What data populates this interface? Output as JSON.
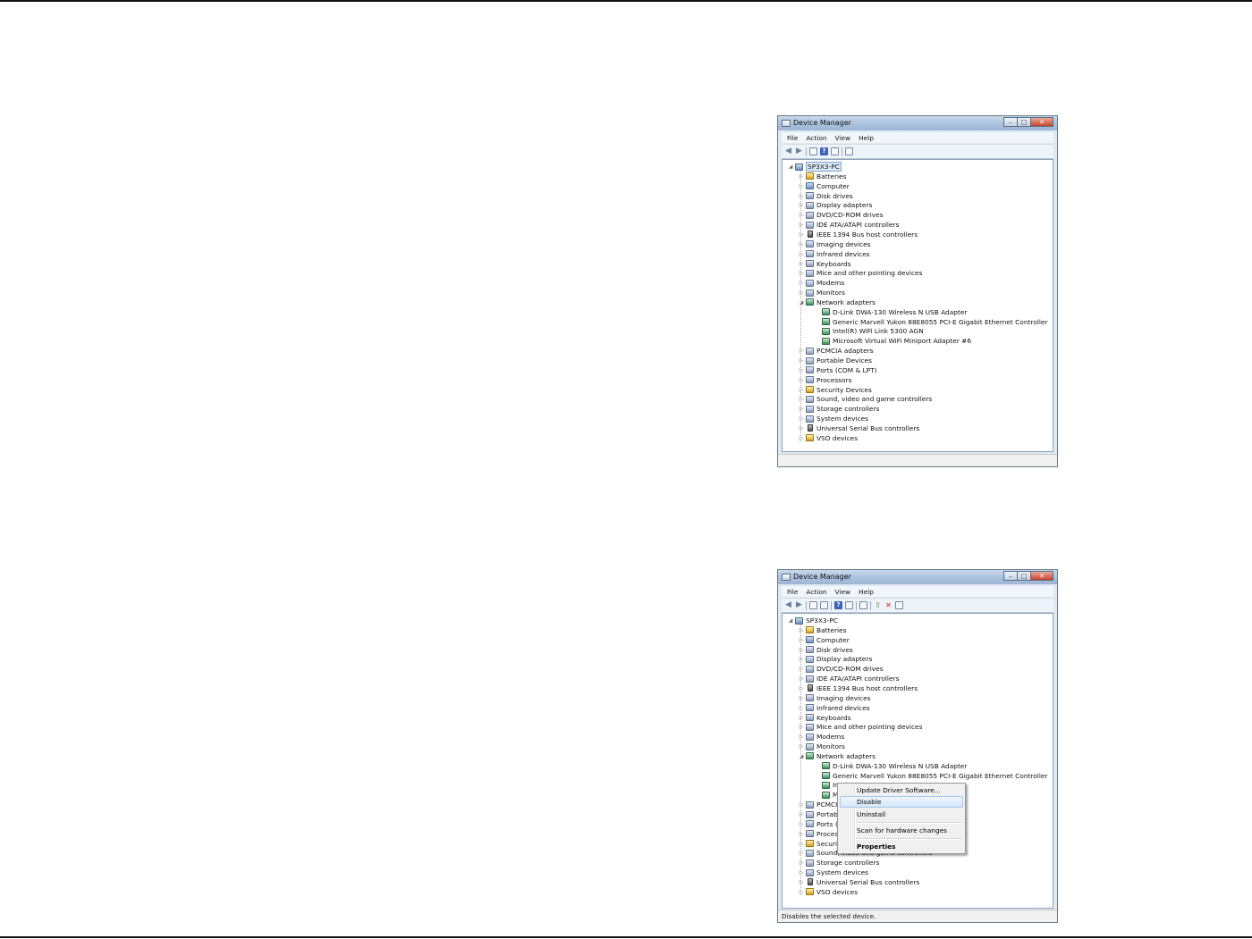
{
  "windows": [
    {
      "title": "Device Manager",
      "menu": [
        "File",
        "Action",
        "View",
        "Help"
      ],
      "toolbar_icons": [
        "back-arrow-icon",
        "forward-arrow-icon",
        "sep",
        "console-tree-icon",
        "help-icon",
        "properties-icon",
        "sep",
        "scan-hardware-icon"
      ],
      "root": "SP3X3-PC",
      "categories": [
        "Batteries",
        "Computer",
        "Disk drives",
        "Display adapters",
        "DVD/CD-ROM drives",
        "IDE ATA/ATAPI controllers",
        "IEEE 1394 Bus host controllers",
        "Imaging devices",
        "Infrared devices",
        "Keyboards",
        "Mice and other pointing devices",
        "Modems",
        "Monitors",
        "Network adapters"
      ],
      "network_devices": [
        "D-Link DWA-130 Wireless N USB Adapter",
        "Generic Marvell Yukon 88E8055 PCI-E Gigabit Ethernet Controller",
        "Intel(R) WiFi Link 5300 AGN",
        "Microsoft Virtual WiFi Miniport Adapter #6"
      ],
      "categories_after": [
        "PCMCIA adapters",
        "Portable Devices",
        "Ports (COM & LPT)",
        "Processors",
        "Security Devices",
        "Sound, video and game controllers",
        "Storage controllers",
        "System devices",
        "Universal Serial Bus controllers",
        "VSO devices"
      ],
      "status": ""
    },
    {
      "title": "Device Manager",
      "menu": [
        "File",
        "Action",
        "View",
        "Help"
      ],
      "toolbar_icons": [
        "back-arrow-icon",
        "forward-arrow-icon",
        "sep",
        "console-tree-icon",
        "show-hide-icon",
        "sep",
        "help-icon",
        "properties-icon",
        "sep",
        "scan-hardware-icon",
        "sep",
        "update-driver-icon",
        "uninstall-icon",
        "disable-icon"
      ],
      "root": "SP3X3-PC",
      "categories": [
        "Batteries",
        "Computer",
        "Disk drives",
        "Display adapters",
        "DVD/CD-ROM drives",
        "IDE ATA/ATAPI controllers",
        "IEEE 1394 Bus host controllers",
        "Imaging devices",
        "Infrared devices",
        "Keyboards",
        "Mice and other pointing devices",
        "Modems",
        "Monitors",
        "Network adapters"
      ],
      "network_devices": [
        "D-Link DWA-130 Wireless N USB Adapter",
        "Generic Marvell Yukon 88E8055 PCI-E Gigabit Ethernet Controller",
        "Intel",
        "Micr"
      ],
      "categories_after": [
        "PCMCIA",
        "Portable",
        "Ports (C",
        "Process",
        "Security",
        "Sound, video and game controllers",
        "Storage controllers",
        "System devices",
        "Universal Serial Bus controllers",
        "VSO devices"
      ],
      "status": "Disables the selected device."
    }
  ],
  "context_menu": {
    "items": [
      "Update Driver Software...",
      "Disable",
      "Uninstall",
      "Scan for hardware changes",
      "Properties"
    ],
    "highlighted": "Disable"
  }
}
